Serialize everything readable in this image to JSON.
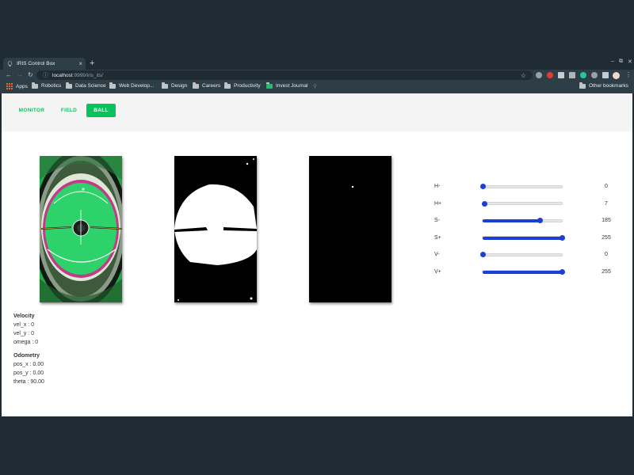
{
  "browser": {
    "tab_title": "IRIS Control Box",
    "url_host": "localhost",
    "url_path": ":9999/iris_its/",
    "bookmarks": [
      "Apps",
      "Robotics",
      "Data Science",
      "Web Develop...",
      "Design",
      "Careers",
      "Productivity",
      "Invest Journal"
    ],
    "other_bookmarks": "Other bookmarks"
  },
  "nav": {
    "items": [
      "MONITOR",
      "FIELD",
      "BALL"
    ],
    "active": "BALL",
    "accent_color": "#07c35b"
  },
  "cameras": [
    "camera-view",
    "threshold-view",
    "ball-mask-view"
  ],
  "sliders": [
    {
      "label": "H-",
      "value": "0",
      "fraction": 0.0
    },
    {
      "label": "H+",
      "value": "7",
      "fraction": 0.027
    },
    {
      "label": "S-",
      "value": "185",
      "fraction": 0.725
    },
    {
      "label": "S+",
      "value": "255",
      "fraction": 1.0
    },
    {
      "label": "V-",
      "value": "0",
      "fraction": 0.0
    },
    {
      "label": "V+",
      "value": "255",
      "fraction": 1.0
    }
  ],
  "slider_color": "#1b3fd6",
  "velocity": {
    "title": "Velocity",
    "lines": [
      "vel_x : 0",
      "vel_y : 0",
      "omega : 0"
    ]
  },
  "odometry": {
    "title": "Odometry",
    "lines": [
      "pos_x : 0.00",
      "pos_y : 0.00",
      "theta : 90.00"
    ]
  }
}
